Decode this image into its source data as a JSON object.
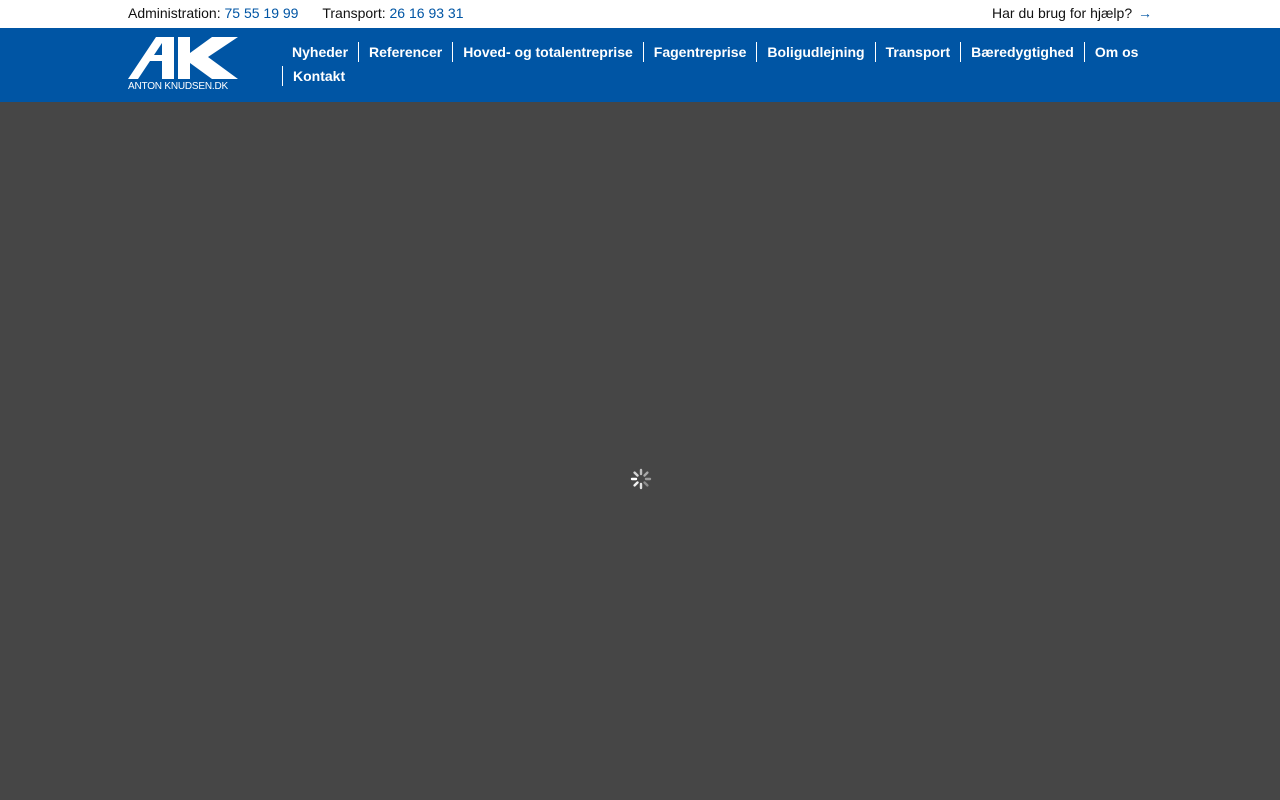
{
  "topbar": {
    "admin_label": "Administration:",
    "admin_phone": "75 55 19 99",
    "transport_label": "Transport:",
    "transport_phone": "26 16 93 31",
    "help_text": "Har du brug for hjælp?",
    "help_arrow": "→"
  },
  "logo": {
    "text": "ANTON KNUDSEN.DK"
  },
  "nav": {
    "items": [
      {
        "label": "Nyheder"
      },
      {
        "label": "Referencer"
      },
      {
        "label": "Hoved- og totalentreprise"
      },
      {
        "label": "Fagentreprise"
      },
      {
        "label": "Boligudlejning"
      },
      {
        "label": "Transport"
      },
      {
        "label": "Bæredygtighed"
      },
      {
        "label": "Om os"
      },
      {
        "label": "Kontakt"
      }
    ]
  },
  "colors": {
    "brand_blue": "#0055a4",
    "content_bg": "#464646",
    "topbar_bg": "#ffffff"
  },
  "icons": {
    "loading": "loading-spinner-icon",
    "help_arrow": "arrow-right-icon"
  }
}
